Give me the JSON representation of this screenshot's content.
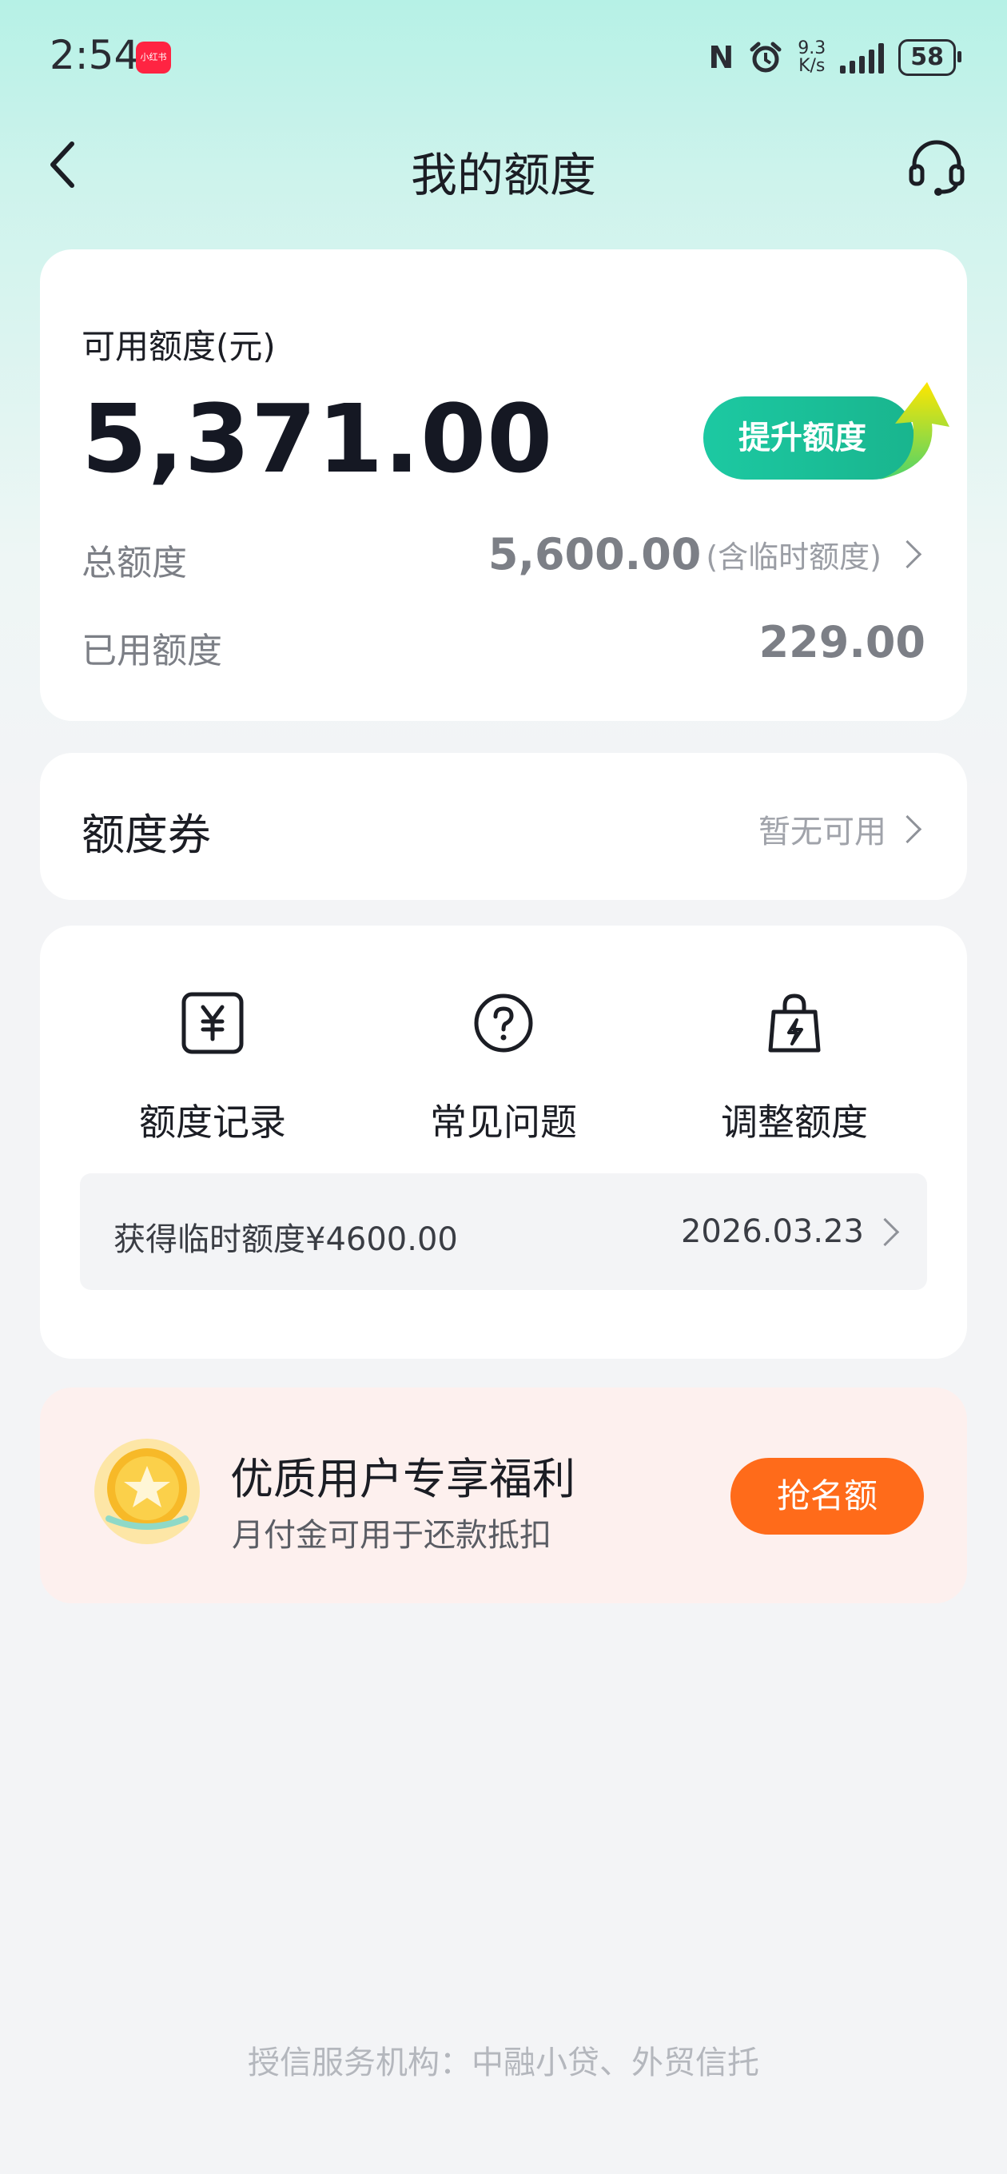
{
  "status_bar": {
    "time": "2:54",
    "app_badge": "小红书",
    "nfc": "N",
    "net_speed_value": "9.3",
    "net_speed_unit": "K/s",
    "battery": "58"
  },
  "header": {
    "title": "我的额度",
    "back_icon": "chevron-left-icon",
    "support_icon": "headset-icon"
  },
  "credit": {
    "available_label": "可用额度(元)",
    "available_amount": "5,371.00",
    "raise_button": "提升额度",
    "total_label": "总额度",
    "total_amount": "5,600.00",
    "total_note": "(含临时额度)",
    "used_label": "已用额度",
    "used_amount": "229.00"
  },
  "coupon": {
    "title": "额度券",
    "status": "暂无可用"
  },
  "features": [
    {
      "label": "额度记录",
      "icon": "yuan-record-icon"
    },
    {
      "label": "常见问题",
      "icon": "question-icon"
    },
    {
      "label": "调整额度",
      "icon": "shopping-bag-bolt-icon"
    }
  ],
  "record": {
    "text": "获得临时额度¥4600.00",
    "date": "2026.03.23"
  },
  "promo": {
    "title": "优质用户专享福利",
    "subtitle": "月付金可用于还款抵扣",
    "button": "抢名额"
  },
  "footer": {
    "text": "授信服务机构：中融小贷、外贸信托"
  },
  "colors": {
    "accent_green": "#1cc9a2",
    "promo_orange": "#ff6b1a",
    "header_gradient_top": "#b6f1e6"
  }
}
